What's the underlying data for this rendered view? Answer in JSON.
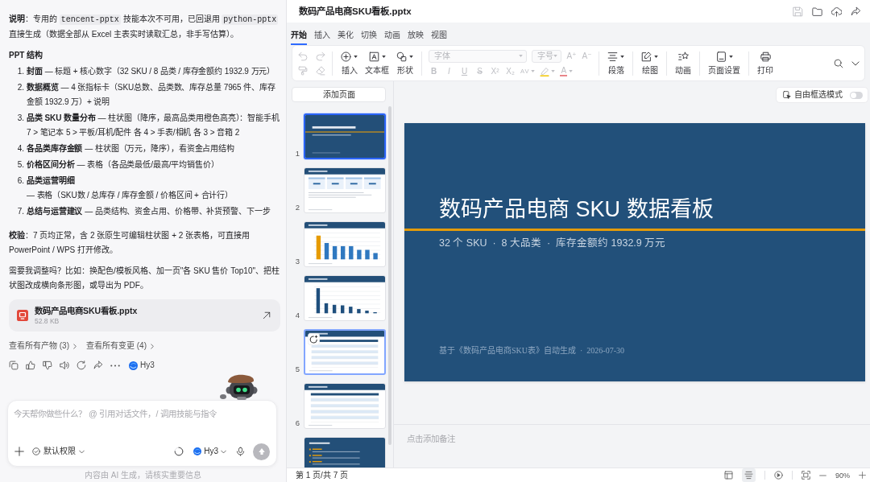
{
  "chat": {
    "note": [
      {
        "kind": "bold",
        "text": "说明"
      },
      {
        "kind": "text",
        "text": "：专用的 "
      },
      {
        "kind": "code",
        "text": "tencent-pptx"
      },
      {
        "kind": "text",
        "text": " 技能本次不可用，已回退用 "
      },
      {
        "kind": "code",
        "text": "python-pptx"
      },
      {
        "kind": "text",
        "text": " 直接生成（数据全部从 Excel 主表实时读取汇总，非手写估算）。"
      }
    ],
    "outline_heading": "PPT 结构",
    "outline": [
      {
        "number": "1.",
        "title": "封面",
        "text": "— 标题 + 核心数字（32 SKU / 8 品类 / 库存金额约 1932.9 万元）"
      },
      {
        "number": "2.",
        "title": "数据概览",
        "text": "— 4 张指标卡（SKU总数、品类数、库存总量 7965 件、库存金额 1932.9 万）+ 说明"
      },
      {
        "number": "3.",
        "title": "品类 SKU 数量分布",
        "text": "— 柱状图（降序，最高品类用橙色高亮）：智能手机 7 > 笔记本 5 > 平板/耳机/配件 各 4 > 手表/相机 各 3 > 音箱 2"
      },
      {
        "number": "4.",
        "title": "各品类库存金额",
        "text": "— 柱状图（万元，降序），看资金占用结构"
      },
      {
        "number": "5.",
        "title": "价格区间分析",
        "text": "— 表格（各品类最低/最高/平均销售价）"
      },
      {
        "number": "6.",
        "title": "品类运营明细",
        "next_line": "— 表格（SKU数 / 总库存 / 库存金额 / 价格区间 + 合计行）"
      },
      {
        "number": "7.",
        "title": "总结与运营建议",
        "text": "— 品类结构、资金占用、价格带、补货预警、下一步"
      }
    ],
    "check": "**校验**：7 页均正常，含 2 张原生可编辑柱状图 + 2 张表格，可直接用 PowerPoint / WPS 打开修改。",
    "question": "需要我调整吗？比如：换配色/模板风格、加一页\"各 SKU 售价 Top10\"、把柱状图改成横向条形图，或导出为 PDF。",
    "attachment": {
      "name": "数码产品电商SKU看板.pptx",
      "size": "52.8 KB"
    },
    "links": [
      "查看所有产物 (3)",
      "查看所有变更 (4)"
    ],
    "reply_model": "Hy3",
    "composer": {
      "placeholder": "今天帮你做些什么？ @ 引用对话文件，/ 调用技能与指令",
      "permission": "默认权限",
      "model": "Hy3",
      "send_disabled": true
    },
    "disclaimer": "内容由 AI 生成，请核实重要信息"
  },
  "editor": {
    "file_name": "数码产品电商SKU看板.pptx",
    "title_actions": [
      {
        "disabled": true
      },
      {
        "disabled": false
      },
      {
        "disabled": false
      },
      {
        "disabled": false
      }
    ],
    "tabs": [
      {
        "label": "开始",
        "selected": true
      },
      {
        "label": "插入",
        "selected": false
      },
      {
        "label": "美化",
        "selected": false
      },
      {
        "label": "切换",
        "selected": false
      },
      {
        "label": "动画",
        "selected": false
      },
      {
        "label": "放映",
        "selected": false
      },
      {
        "label": "视图",
        "selected": false
      }
    ],
    "toolbar": {
      "history": [
        {
          "disabled": true
        },
        {
          "disabled": true
        },
        {
          "disabled": true
        },
        {
          "disabled": true
        }
      ],
      "insert": [
        {
          "label": "插入",
          "dropdown": true
        },
        {
          "label": "文本框",
          "dropdown": true
        },
        {
          "label": "形状",
          "dropdown": true
        }
      ],
      "font": {
        "placeholder": "字体",
        "disabled": true
      },
      "font_size": {
        "placeholder": "字号",
        "disabled": true
      },
      "size_buttons": [
        {
          "label": "A⁺",
          "disabled": true
        },
        {
          "label": "A⁻",
          "disabled": true
        }
      ],
      "format": [
        {
          "kind": "text",
          "label": "B",
          "dropdown": false,
          "disabled": true
        },
        {
          "kind": "text",
          "label": "I",
          "dropdown": false,
          "disabled": true
        },
        {
          "kind": "text",
          "label": "U",
          "dropdown": false,
          "disabled": true
        },
        {
          "kind": "text",
          "label": "S",
          "dropdown": false,
          "disabled": true
        },
        {
          "kind": "text",
          "label": "X²",
          "dropdown": false,
          "disabled": true
        },
        {
          "kind": "text",
          "label": "X₂",
          "dropdown": false,
          "disabled": true
        },
        {
          "kind": "text",
          "label": "AV",
          "dropdown": true,
          "disabled": true
        },
        {
          "kind": "icon",
          "dropdown": true,
          "disabled": true
        },
        {
          "kind": "text",
          "label": "A",
          "dropdown": true,
          "disabled": true
        }
      ],
      "groups": [
        {
          "label": "段落",
          "dropdown": true
        },
        {
          "label": "绘图",
          "dropdown": true
        },
        {
          "label": "动画",
          "dropdown": false
        },
        {
          "label": "页面设置",
          "dropdown": true
        },
        {
          "label": "打印",
          "dropdown": false
        }
      ]
    },
    "add_page": "添加页面",
    "thumbnails": [
      {
        "number": "1",
        "kind": "title",
        "selected": true,
        "hovered": false
      },
      {
        "number": "2",
        "kind": "cards",
        "selected": false,
        "hovered": false
      },
      {
        "number": "3",
        "kind": "bars_highlight",
        "selected": false,
        "hovered": false
      },
      {
        "number": "4",
        "kind": "bars",
        "selected": false,
        "hovered": false
      },
      {
        "number": "5",
        "kind": "table",
        "selected": false,
        "hovered": true
      },
      {
        "number": "6",
        "kind": "table",
        "selected": false,
        "hovered": false
      },
      {
        "kind": "bullets",
        "selected": false,
        "hovered": false
      }
    ],
    "select_mode": {
      "label": "自由框选模式",
      "on": false
    },
    "slide": {
      "title": "数码产品电商 SKU 数据看板",
      "subtitle": "32 个 SKU  ·  8 大品类  ·  库存金额约 1932.9 万元",
      "footer": "基于《数码产品电商SKU表》自动生成  ·  2026-07-30"
    },
    "notes_placeholder": "点击添加备注",
    "status_bar": {
      "page": "第 1 页/共 7 页",
      "views": [
        {
          "selected": false
        },
        {
          "selected": true
        }
      ],
      "zoom": "90%"
    }
  }
}
